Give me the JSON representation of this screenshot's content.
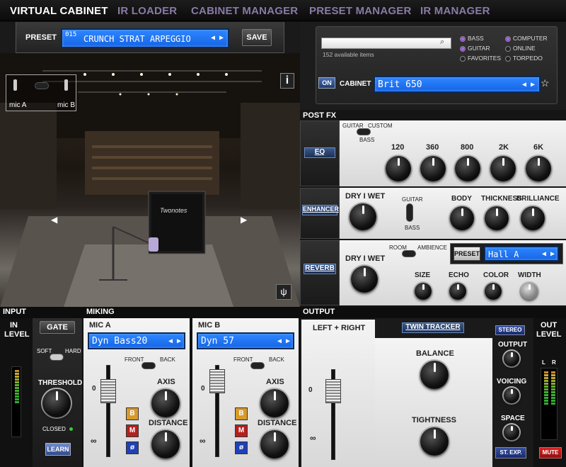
{
  "tabs": [
    "VIRTUAL CABINET",
    "IR LOADER",
    "CABINET MANAGER",
    "PRESET MANAGER",
    "IR MANAGER"
  ],
  "preset": {
    "label": "PRESET",
    "number": "015",
    "name": "CRUNCH STRAT ARPEGGIO",
    "save": "SAVE"
  },
  "stage": {
    "mic_a": "mic A",
    "mic_b": "mic B",
    "info": "i",
    "cab_brand": "Twonotes"
  },
  "browser": {
    "search_value": "",
    "count": "152 available items",
    "filters_left": [
      {
        "label": "BASS",
        "on": true
      },
      {
        "label": "GUITAR",
        "on": true
      },
      {
        "label": "FAVORITES",
        "on": false
      }
    ],
    "filters_right": [
      {
        "label": "COMPUTER",
        "on": true
      },
      {
        "label": "ONLINE",
        "on": false
      },
      {
        "label": "TORPEDO",
        "on": false
      }
    ],
    "on": "ON",
    "cabinet_label": "CABINET",
    "cabinet_name": "Brit 650"
  },
  "postfx": {
    "title": "POST FX",
    "eq": {
      "button": "EQ",
      "mode_guitar": "GUITAR",
      "mode_custom": "CUSTOM",
      "mode_bass": "BASS",
      "bands": [
        "120",
        "360",
        "800",
        "2K",
        "6K"
      ]
    },
    "enhancer": {
      "button": "ENHANCER",
      "drywet": "DRY I WET",
      "guitar": "GUITAR",
      "bass": "BASS",
      "knobs": [
        "BODY",
        "THICKNESS",
        "BRILLIANCE"
      ]
    },
    "reverb": {
      "button": "REVERB",
      "drywet": "DRY I WET",
      "room": "ROOM",
      "ambience": "AMBIENCE",
      "preset_btn": "PRESET",
      "preset_name": "Hall A",
      "knobs": [
        "SIZE",
        "ECHO",
        "COLOR",
        "WIDTH"
      ]
    }
  },
  "input": {
    "title": "INPUT",
    "in_level": "IN",
    "in_level2": "LEVEL",
    "gate": "GATE",
    "soft": "SOFT",
    "hard": "HARD",
    "threshold": "THRESHOLD",
    "closed": "CLOSED",
    "learn": "LEARN"
  },
  "miking": {
    "title": "MIKING",
    "mic_a": {
      "label": "MIC A",
      "model": "Dyn Bass20",
      "front": "FRONT",
      "back": "BACK",
      "axis": "AXIS",
      "distance": "DISTANCE"
    },
    "mic_b": {
      "label": "MIC B",
      "model": "Dyn 57",
      "front": "FRONT",
      "back": "BACK",
      "axis": "AXIS",
      "distance": "DISTANCE"
    },
    "zero": "0",
    "inf": "∞",
    "b": "B",
    "m": "M",
    "phi": "ø"
  },
  "output": {
    "title": "OUTPUT",
    "tab_lr": "LEFT + RIGHT",
    "tab_twin": "TWIN TRACKER",
    "balance": "BALANCE",
    "tightness": "TIGHTNESS",
    "stereo": "STEREO",
    "out_knob": "OUTPUT",
    "voicing": "VOICING",
    "space": "SPACE",
    "st_exp": "ST. EXP.",
    "mute": "MUTE",
    "out": "OUT",
    "level": "LEVEL",
    "l": "L",
    "r": "R",
    "zero": "0",
    "inf": "∞"
  },
  "colors": {
    "lcd": "#1f73f0",
    "accent": "#8a7aa6",
    "mute": "#b01818",
    "tab_active": "#ffffff"
  }
}
